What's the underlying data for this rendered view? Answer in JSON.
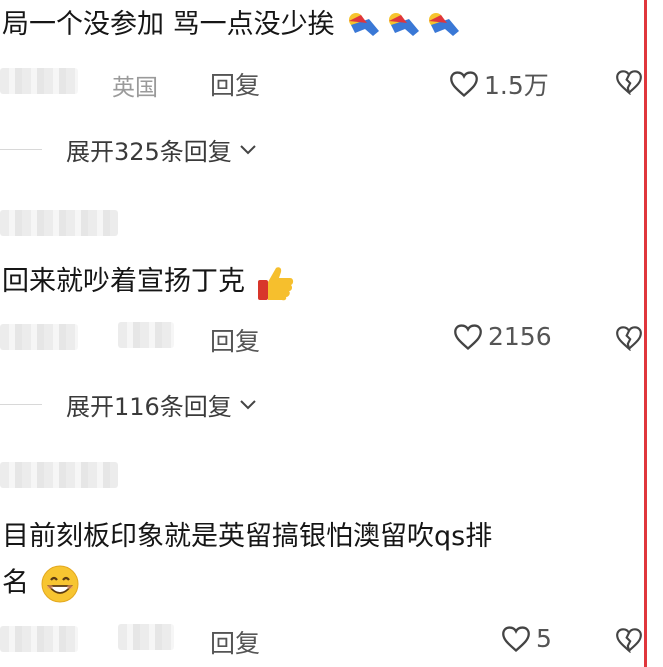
{
  "comments": [
    {
      "text": "局一个没参加 骂一点没少挨",
      "location": "英国",
      "reply_label": "回复",
      "likes": "1.5万",
      "expand_label": "展开325条回复",
      "emoji": [
        "flying-person-emoji",
        "flying-person-emoji",
        "flying-person-emoji"
      ]
    },
    {
      "text": "回来就吵着宣扬丁克",
      "location": "",
      "reply_label": "回复",
      "likes": "2156",
      "expand_label": "展开116条回复",
      "emoji": [
        "thumbs-up-emoji"
      ]
    },
    {
      "text_line1": "目前刻板印象就是英留搞银怕澳留吹qs排",
      "text_line2": "名",
      "location": "",
      "reply_label": "回复",
      "likes": "5",
      "emoji": [
        "grinning-face-emoji"
      ]
    }
  ],
  "colors": {
    "accent_line": "#e0363c",
    "meta_text": "#555555",
    "location_text": "#9a9a9a"
  }
}
